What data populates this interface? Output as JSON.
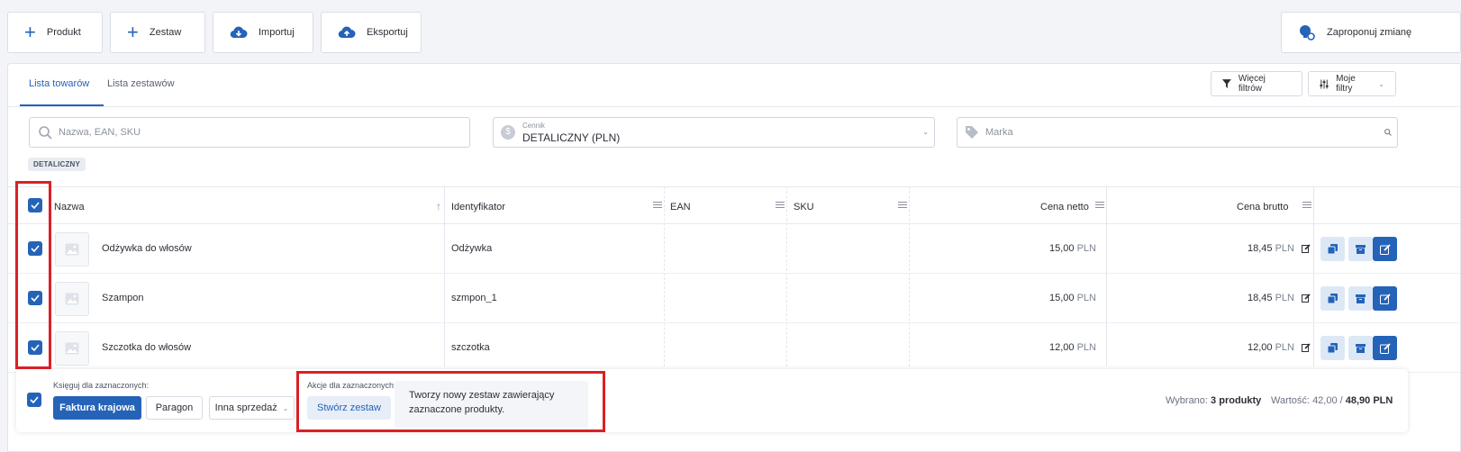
{
  "toolbar": {
    "product": "Produkt",
    "set": "Zestaw",
    "import": "Importuj",
    "export": "Eksportuj",
    "suggest": "Zaproponuj zmianę"
  },
  "tabs": {
    "items": "Lista towarów",
    "sets": "Lista zestawów"
  },
  "filters": {
    "more": "Więcej filtrów",
    "mine": "Moje filtry"
  },
  "search": {
    "placeholder": "Nazwa, EAN, SKU",
    "pricelist_label": "Cennik",
    "pricelist_value": "DETALICZNY (PLN)",
    "brand_placeholder": "Marka",
    "badge": "DETALICZNY"
  },
  "table": {
    "columns": {
      "name": "Nazwa",
      "id": "Identyfikator",
      "ean": "EAN",
      "sku": "SKU",
      "net": "Cena netto",
      "gross": "Cena brutto"
    },
    "currency": "PLN",
    "rows": [
      {
        "name": "Odżywka do włosów",
        "id": "Odżywka",
        "net": "15,00",
        "gross": "18,45"
      },
      {
        "name": "Szampon",
        "id": "szmpon_1",
        "net": "15,00",
        "gross": "18,45"
      },
      {
        "name": "Szczotka do włosów",
        "id": "szczotka",
        "net": "12,00",
        "gross": "12,00"
      }
    ]
  },
  "bottom": {
    "post_label": "Księguj dla zaznaczonych:",
    "invoice": "Faktura krajowa",
    "receipt": "Paragon",
    "other": "Inna sprzedaż",
    "actions_label": "Akcje dla zaznaczonych:",
    "create_set": "Stwórz zestaw",
    "tooltip": "Tworzy nowy zestaw zawierający zaznaczone produkty.",
    "selected_label": "Wybrano:",
    "selected_value": "3 produkty",
    "value_label": "Wartość:",
    "value_net": "42,00 /",
    "value_gross": "48,90 PLN"
  },
  "colors": {
    "accent": "#2563b8",
    "highlight": "#d92126"
  }
}
